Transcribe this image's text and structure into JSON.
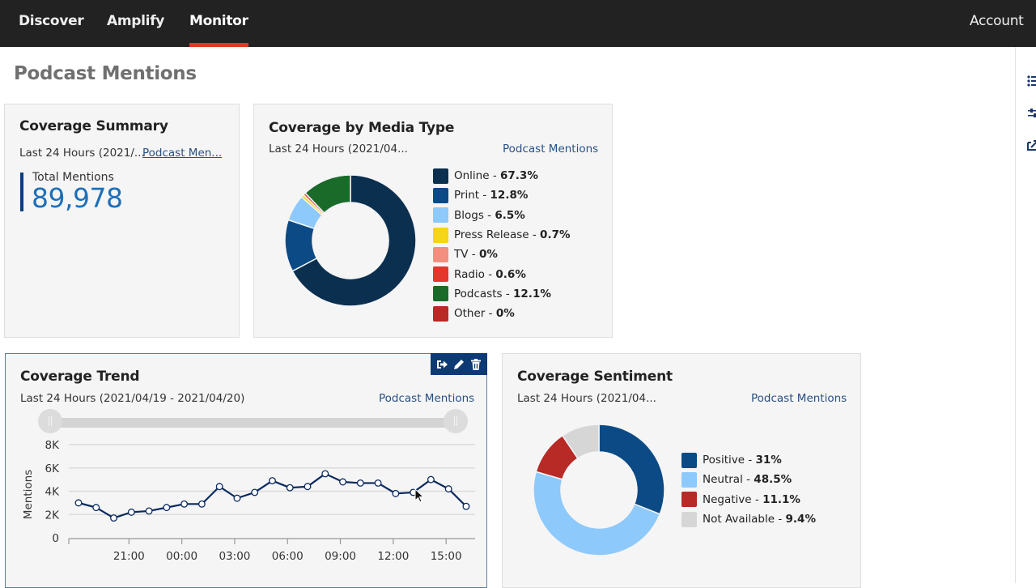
{
  "nav": {
    "items": [
      {
        "label": "Discover",
        "active": false
      },
      {
        "label": "Amplify",
        "active": false
      },
      {
        "label": "Monitor",
        "active": true
      }
    ],
    "account_label": "Account",
    "active_color": "#e2362b"
  },
  "page": {
    "title": "Podcast Mentions"
  },
  "rail": {
    "icons": [
      "list-icon",
      "sliders-icon",
      "share-icon"
    ]
  },
  "summary": {
    "title": "Coverage Summary",
    "range": "Last 24 Hours (2021/...",
    "link": "Podcast Men...",
    "total_label": "Total Mentions",
    "total_value": "89,978"
  },
  "media": {
    "title": "Coverage by Media Type",
    "range": "Last 24 Hours (2021/04...",
    "link": "Podcast Mentions"
  },
  "trend": {
    "title": "Coverage Trend",
    "range": "Last 24 Hours (2021/04/19 - 2021/04/20)",
    "link": "Podcast Mentions",
    "actions": [
      "export-icon",
      "edit-icon",
      "delete-icon"
    ],
    "range_slider": {
      "start": 0,
      "end": 1
    }
  },
  "sentiment": {
    "title": "Coverage Sentiment",
    "range": "Last 24 Hours (2021/04...",
    "link": "Podcast Mentions"
  },
  "chart_data": [
    {
      "type": "pie",
      "title": "Coverage by Media Type",
      "donut": true,
      "categories": [
        "Online",
        "Print",
        "Blogs",
        "Press Release",
        "TV",
        "Radio",
        "Podcasts",
        "Other"
      ],
      "values": [
        67.3,
        12.8,
        6.5,
        0.7,
        0,
        0.6,
        12.1,
        0
      ],
      "labels": [
        "67.3%",
        "12.8%",
        "6.5%",
        "0.7%",
        "0%",
        "0.6%",
        "12.1%",
        "0%"
      ],
      "colors": [
        "#0b2f4f",
        "#0b4a85",
        "#8ec9fb",
        "#f5d515",
        "#f38f7f",
        "#e4362b",
        "#1a6a2a",
        "#b72a25"
      ],
      "legend": "right"
    },
    {
      "type": "line",
      "title": "Coverage Trend",
      "xlabel": "",
      "ylabel": "Mentions",
      "ylim": [
        0,
        8000
      ],
      "yticks": [
        0,
        2000,
        4000,
        6000,
        8000
      ],
      "ytick_labels": [
        "0",
        "2K",
        "4K",
        "6K",
        "8K"
      ],
      "xtick_labels": [
        "21:00",
        "00:00",
        "03:00",
        "06:00",
        "09:00",
        "12:00",
        "15:00"
      ],
      "x_hours": [
        18,
        19,
        20,
        21,
        22,
        23,
        0,
        1,
        2,
        3,
        4,
        5,
        6,
        7,
        8,
        9,
        10,
        11,
        12,
        13,
        14,
        15,
        16
      ],
      "series": [
        {
          "name": "Mentions",
          "color": "#0b2a5f",
          "values": [
            3000,
            2600,
            1700,
            2200,
            2300,
            2600,
            2900,
            2900,
            4400,
            3400,
            3900,
            4900,
            4300,
            4400,
            5500,
            4800,
            4700,
            4700,
            3800,
            3900,
            5000,
            4200,
            2700
          ]
        }
      ],
      "grid": true
    },
    {
      "type": "pie",
      "title": "Coverage Sentiment",
      "donut": true,
      "categories": [
        "Positive",
        "Neutral",
        "Negative",
        "Not Available"
      ],
      "values": [
        31,
        48.5,
        11.1,
        9.4
      ],
      "labels": [
        "31%",
        "48.5%",
        "11.1%",
        "9.4%"
      ],
      "colors": [
        "#0b4a85",
        "#8ec9fb",
        "#b72a25",
        "#d6d6d6"
      ],
      "legend": "right"
    }
  ]
}
